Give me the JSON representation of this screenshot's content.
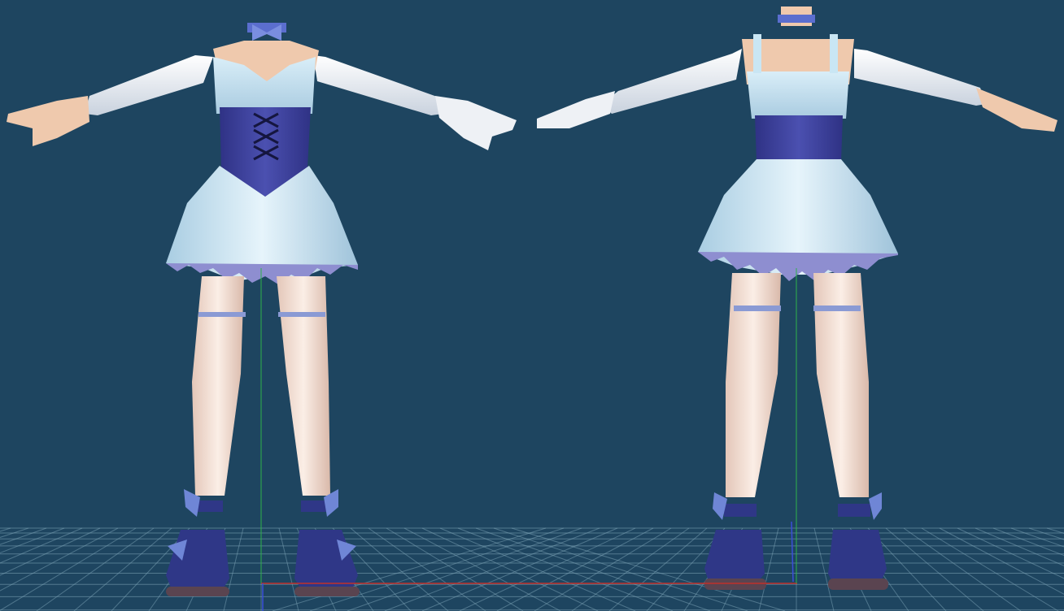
{
  "viewport": {
    "background": "#1e4560",
    "grid_color": "#7fa6b8",
    "axis_x_color": "#c0302a",
    "axis_y_color": "#2fb34a",
    "axis_z_color": "#3a4fd8"
  },
  "model_palette": {
    "skin": "#efc9ad",
    "glove": "#eef1f5",
    "dress_light": "#c9e6f4",
    "dress_shadow": "#8fb9d3",
    "corset": "#3b3f9a",
    "corset_lace": "#1b1c52",
    "stocking": "#f1ddd2",
    "shoe": "#2f3787",
    "sole": "#5a4450",
    "ribbon": "#6f86d6",
    "frill": "#a8a8d8"
  },
  "views": [
    {
      "id": "front",
      "label": ""
    },
    {
      "id": "back",
      "label": ""
    }
  ]
}
